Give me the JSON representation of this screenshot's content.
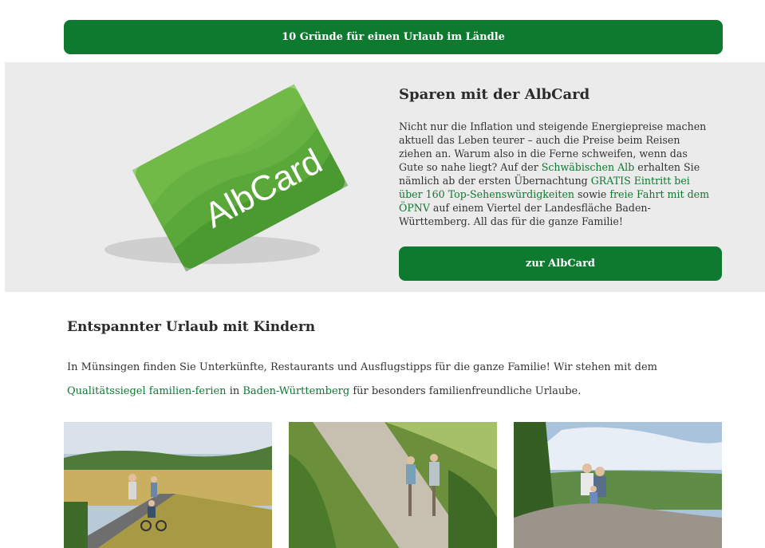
{
  "top_button": {
    "label": "10 Gründe für einen Urlaub im Ländle"
  },
  "albcard": {
    "card_logo": "AlbCard",
    "title": "Sparen mit der AlbCard",
    "text_1": "Nicht nur die Inflation und steigende Energiepreise machen aktuell das Leben teurer – auch die Preise beim Reisen ziehen an. Warum also in die Ferne schweifen, wenn das Gute so nahe liegt? Auf der ",
    "link_1": "Schwäbischen Alb",
    "text_2": " erhalten Sie nämlich ab der ersten Übernachtung ",
    "link_2": "GRATIS Eintritt bei über 160 Top-Sehenswürdigkeiten",
    "text_3": " sowie ",
    "link_3": "freie Fahrt mit dem ÖPNV",
    "text_4": " auf einem Viertel der Landesfläche Baden-Württemberg. All das für die ganze Familie!",
    "button_label": "zur AlbCard"
  },
  "kids": {
    "title": "Entspannter Urlaub mit Kindern",
    "text_1": "In Münsingen finden Sie Unterkünfte, Restaurants und Ausflugstipps für die ganze Familie! Wir stehen mit dem ",
    "link_1": "Qualitätssiegel familien-ferien",
    "text_2": " in ",
    "link_2": "Baden-Württemberg",
    "text_3": " für besonders familienfreundliche Urlaube."
  },
  "colors": {
    "brand_green": "#0d7a30",
    "section_bg": "#ebebeb",
    "card_green": "#5aa83a"
  }
}
